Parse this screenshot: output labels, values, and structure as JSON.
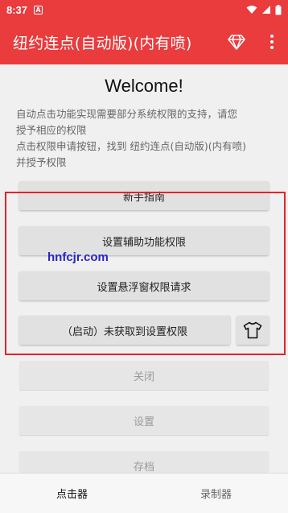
{
  "status_bar": {
    "time": "8:37",
    "notification_letter": "A"
  },
  "app_bar": {
    "title": "纽约连点(自动版)(内有喷)"
  },
  "welcome": {
    "heading": "Welcome!",
    "line1": "自动点击功能实现需要部分系统权限的支持，请您",
    "line2": "授予相应的权限",
    "line3": "点击权限申请按钮，找到 纽约连点(自动版)(内有喷)",
    "line4": "并授予权限"
  },
  "buttons": {
    "guide": "新手指南",
    "accessibility": "设置辅助功能权限",
    "overlay": "设置悬浮窗权限请求",
    "start": "（启动）未获取到设置权限",
    "close": "关闭",
    "settings": "设置",
    "archive": "存档"
  },
  "watermark": "hnfcjr.com",
  "bottom_nav": {
    "clicker": "点击器",
    "recorder": "录制器"
  },
  "colors": {
    "accent": "#ea3b3d",
    "frame": "#e2242a"
  }
}
